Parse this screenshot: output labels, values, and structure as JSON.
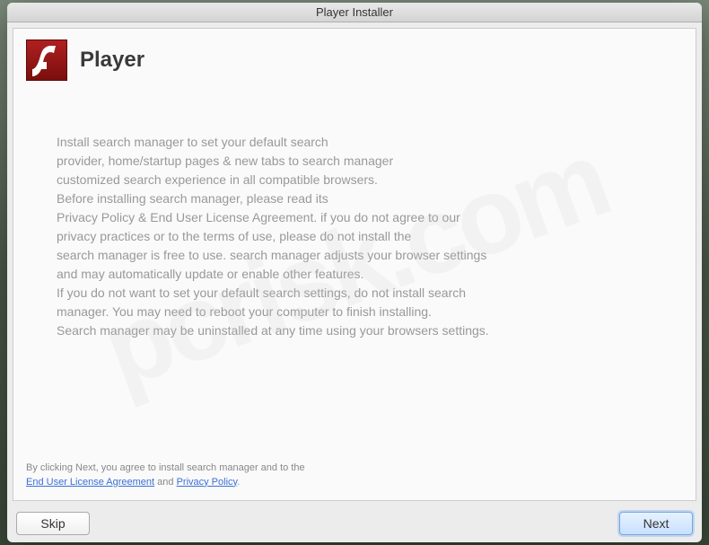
{
  "window": {
    "title": "Player Installer"
  },
  "header": {
    "appName": "Player"
  },
  "body": {
    "l1": "Install search manager to set your default search",
    "l2": "provider, home/startup pages & new tabs to search manager",
    "l3": "customized search experience in all compatible browsers.",
    "l4": "Before installing search manager, please read its",
    "l5": "Privacy Policy & End User License Agreement. if you do not agree to our",
    "l6": "privacy practices or to the terms of use, please do not install the",
    "l7": "search manager is free to use. search manager adjusts your browser settings",
    "l8": "and may automatically update or enable other features.",
    "l9": "If you do not want to set your default search settings, do not install search",
    "l10": "manager. You may need to reboot your computer to finish installing.",
    "l11": "Search manager may be uninstalled at any time using your browsers settings."
  },
  "footer": {
    "prefix": "By clicking Next, you agree to install search manager and to the",
    "eula": "End User License Agreement",
    "and": " and ",
    "privacy": "Privacy Policy",
    "suffix": "."
  },
  "buttons": {
    "skip": "Skip",
    "next": "Next"
  },
  "watermark": "pcrisk.com"
}
